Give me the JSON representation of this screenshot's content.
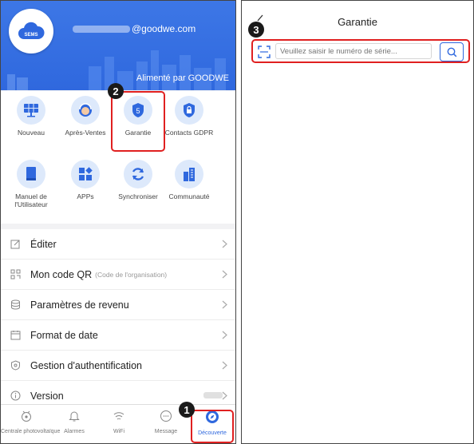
{
  "left": {
    "header": {
      "avatar_label": "SEMS",
      "email_suffix": "@goodwe.com",
      "powered_by": "Alimenté par GOODWE"
    },
    "grid": [
      {
        "label": "Nouveau",
        "icon": "solar-panel-icon"
      },
      {
        "label": "Après-Ventes",
        "icon": "support-agent-icon"
      },
      {
        "label": "Garantie",
        "icon": "warranty-shield-icon"
      },
      {
        "label": "Contacts GDPR",
        "icon": "lock-shield-icon"
      },
      {
        "label": "Manuel de l'Utilisateur",
        "icon": "manual-book-icon"
      },
      {
        "label": "APPs",
        "icon": "apps-icon"
      },
      {
        "label": "Synchroniser",
        "icon": "sync-icon"
      },
      {
        "label": "Communauté",
        "icon": "community-buildings-icon"
      }
    ],
    "list": [
      {
        "label": "Éditer",
        "sub": "",
        "icon": "edit-icon"
      },
      {
        "label": "Mon code QR",
        "sub": "(Code de l'organisation)",
        "icon": "qr-code-icon"
      },
      {
        "label": "Paramètres de revenu",
        "sub": "",
        "icon": "coins-icon"
      },
      {
        "label": "Format de date",
        "sub": "",
        "icon": "calendar-icon"
      },
      {
        "label": "Gestion d'authentification",
        "sub": "",
        "icon": "auth-icon"
      },
      {
        "label": "Version",
        "sub": "",
        "icon": "info-icon"
      }
    ],
    "tabs": [
      {
        "label": "Centrale photovoltaïque",
        "icon": "plant-icon"
      },
      {
        "label": "Alarmes",
        "icon": "bell-icon"
      },
      {
        "label": "WiFi",
        "icon": "wifi-icon"
      },
      {
        "label": "Message",
        "icon": "message-icon"
      },
      {
        "label": "Découverte",
        "icon": "compass-icon",
        "active": true
      }
    ]
  },
  "right": {
    "title": "Garantie",
    "search_placeholder": "Veuillez saisir le numéro de série..."
  },
  "callouts": [
    "1",
    "2",
    "3"
  ],
  "colors": {
    "primary": "#2f68de",
    "highlight": "#e02020",
    "callout": "#1a1a1a"
  }
}
